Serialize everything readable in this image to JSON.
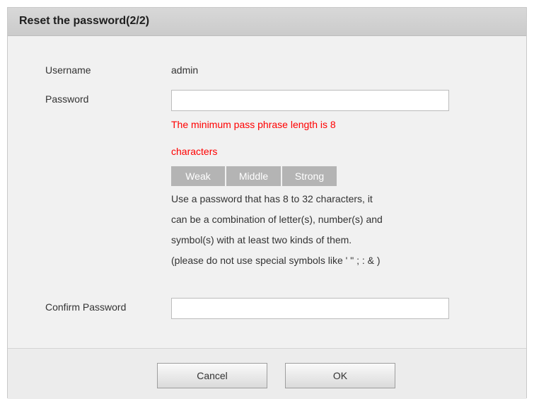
{
  "dialog": {
    "title": "Reset the password(2/2)"
  },
  "form": {
    "username_label": "Username",
    "username_value": "admin",
    "password_label": "Password",
    "password_value": "",
    "error_line1": "The minimum pass phrase length is 8",
    "error_line2": "characters",
    "strength": {
      "weak": "Weak",
      "middle": "Middle",
      "strong": "Strong"
    },
    "hint_lines": [
      "Use a password that has 8 to 32 characters, it",
      "can be a combination of letter(s), number(s) and",
      "symbol(s) with at least two kinds of them.",
      "(please do not use special symbols like ' \" ; : & )"
    ],
    "confirm_label": "Confirm Password",
    "confirm_value": ""
  },
  "buttons": {
    "cancel": "Cancel",
    "ok": "OK"
  },
  "colors": {
    "error": "#ff0000",
    "strength_bar": "#b4b4b4"
  }
}
